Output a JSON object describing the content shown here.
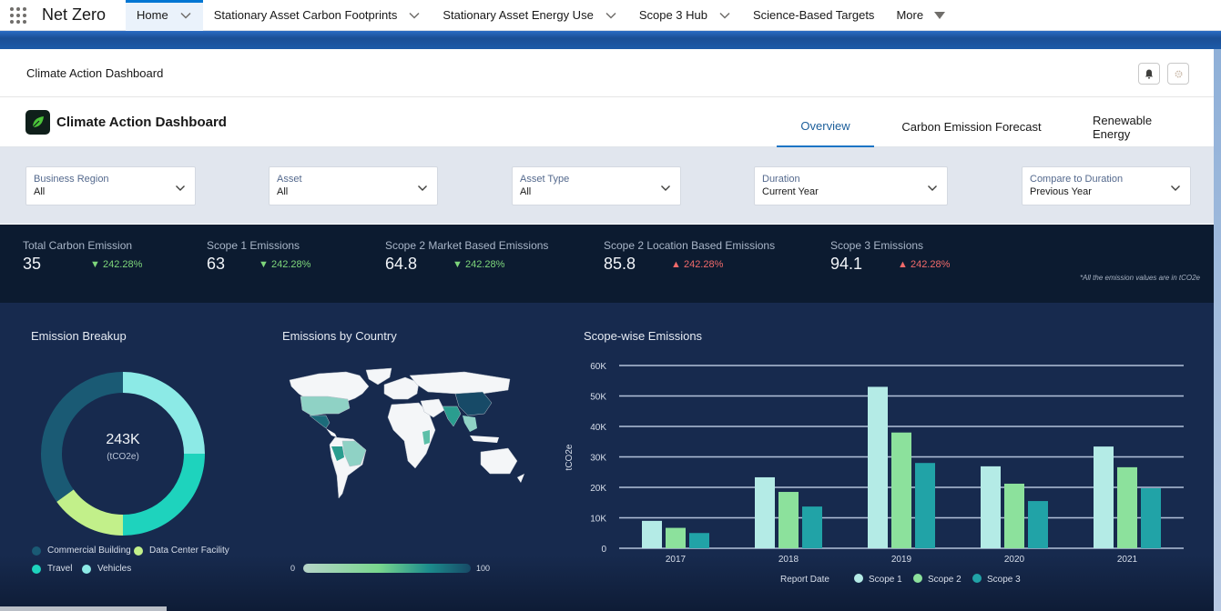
{
  "topnav": {
    "app_name": "Net Zero",
    "items": [
      {
        "label": "Home",
        "has_chevron": true,
        "active": true
      },
      {
        "label": "Stationary Asset Carbon Footprints",
        "has_chevron": true
      },
      {
        "label": "Stationary Asset Energy Use",
        "has_chevron": true
      },
      {
        "label": "Scope 3  Hub",
        "has_chevron": true
      },
      {
        "label": "Science-Based Targets",
        "has_chevron": false
      },
      {
        "label": "More",
        "has_chevron": false,
        "dropdown_triangle": true
      }
    ]
  },
  "page_header": {
    "title": "Climate Action Dashboard",
    "buttons": [
      {
        "icon": "bell-icon"
      },
      {
        "icon": "gear-icon"
      }
    ]
  },
  "dashboard": {
    "title": "Climate Action Dashboard",
    "logo_icon": "leaf-icon",
    "tabs": [
      {
        "label": "Overview",
        "active": true
      },
      {
        "label": "Carbon Emission Forecast",
        "active": false
      },
      {
        "label": "Renewable Energy",
        "active": false
      }
    ]
  },
  "filters": [
    {
      "label": "Business Region",
      "value": "All"
    },
    {
      "label": "Asset",
      "value": "All"
    },
    {
      "label": "Asset Type",
      "value": "All"
    },
    {
      "label": "Duration",
      "value": "Current Year"
    },
    {
      "label": "Compare to Duration",
      "value": "Previous Year"
    }
  ],
  "kpis": [
    {
      "label": "Total Carbon Emission",
      "value": "35",
      "delta": "242.28%",
      "direction": "down"
    },
    {
      "label": "Scope 1 Emissions",
      "value": "63",
      "delta": "242.28%",
      "direction": "down"
    },
    {
      "label": "Scope 2 Market Based Emissions",
      "value": "64.8",
      "delta": "242.28%",
      "direction": "down"
    },
    {
      "label": "Scope 2 Location Based Emissions",
      "value": "85.8",
      "delta": "242.28%",
      "direction": "up"
    },
    {
      "label": "Scope 3 Emissions",
      "value": "94.1",
      "delta": "242.28%",
      "direction": "up"
    }
  ],
  "kpi_footnote": "*All the emission values are in tCO2e",
  "colors": {
    "delta_down": "#7ed67b",
    "delta_up": "#f06a6a",
    "active_tab": "#1b74c5"
  },
  "emission_breakup": {
    "title": "Emission Breakup",
    "center_value": "243K",
    "center_unit": "(tCO2e)",
    "legend": [
      {
        "label": "Commercial Building",
        "color": "#1a5a74"
      },
      {
        "label": "Data Center Facility",
        "color": "#c2f08a"
      },
      {
        "label": "Travel",
        "color": "#1ed3bd"
      },
      {
        "label": "Vehicles",
        "color": "#8ceae6"
      }
    ]
  },
  "emissions_by_country": {
    "title": "Emissions by Country",
    "scale_min": "0",
    "scale_max": "100"
  },
  "chart_data": [
    {
      "type": "pie",
      "title": "Emission Breakup",
      "donut": true,
      "total_label": "243K",
      "unit": "tCO2e",
      "categories": [
        "Vehicles",
        "Travel",
        "Data Center Facility",
        "Commercial Building"
      ],
      "values": [
        25,
        25,
        15,
        35
      ],
      "value_unit": "percent (estimated)",
      "colors": [
        "#8ceae6",
        "#1ed3bd",
        "#c2f08a",
        "#1a5a74"
      ],
      "legend": "bottom"
    },
    {
      "type": "bar",
      "title": "Scope-wise Emissions",
      "xlabel": "Report Date",
      "ylabel": "tCO2e",
      "categories": [
        "2017",
        "2018",
        "2019",
        "2020",
        "2021"
      ],
      "series": [
        {
          "name": "Scope 1",
          "color": "#b4ebe6",
          "values": [
            9000,
            23300,
            53000,
            26900,
            33400
          ]
        },
        {
          "name": "Scope 2",
          "color": "#8ce19c",
          "values": [
            6700,
            18500,
            38000,
            21200,
            26600
          ]
        },
        {
          "name": "Scope 3",
          "color": "#21a3a7",
          "values": [
            5000,
            13700,
            28000,
            15500,
            19700
          ]
        }
      ],
      "ylim": [
        0,
        60000
      ],
      "yticks": [
        "0",
        "10K",
        "20K",
        "30K",
        "40K",
        "50K",
        "60K"
      ],
      "grid": true,
      "legend": "bottom"
    }
  ]
}
